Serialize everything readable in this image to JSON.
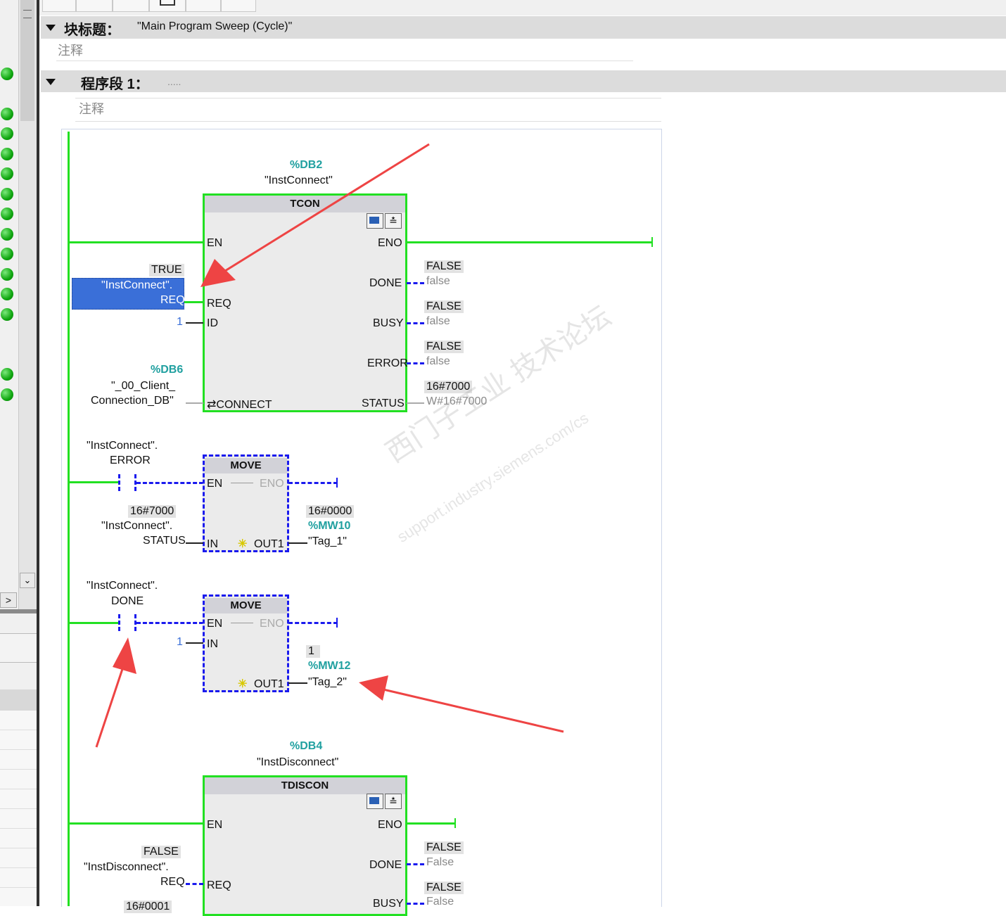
{
  "block": {
    "title_label": "块标题：",
    "title_value": "\"Main Program Sweep (Cycle)\"",
    "comment": "注释"
  },
  "network": {
    "label": "程序段 1：",
    "dots": ".....",
    "comment": "注释"
  },
  "tcon": {
    "db": "%DB2",
    "inst": "\"InstConnect\"",
    "name": "TCON",
    "pin_en": "EN",
    "pin_eno": "ENO",
    "pin_req": "REQ",
    "pin_id": "ID",
    "pin_connect": "⇄CONNECT",
    "pin_done": "DONE",
    "pin_busy": "BUSY",
    "pin_error": "ERROR",
    "pin_status": "STATUS",
    "req_val": "TRUE",
    "req_tag1": "\"InstConnect\".",
    "req_tag2": "REQ",
    "id_val": "1",
    "conn_db": "%DB6",
    "conn_tag1": "\"_00_Client_",
    "conn_tag2": "Connection_DB\"",
    "done_val": "FALSE",
    "done_ref": "false",
    "busy_val": "FALSE",
    "busy_ref": "false",
    "error_val": "FALSE",
    "error_ref": "false",
    "status_val": "16#7000",
    "status_ref": "W#16#7000"
  },
  "move1": {
    "contact_tag1": "\"InstConnect\".",
    "contact_tag2": "ERROR",
    "name": "MOVE",
    "pin_en": "EN",
    "pin_eno": "ENO",
    "pin_in": "IN",
    "pin_out": "OUT1",
    "in_val": "16#7000",
    "in_tag1": "\"InstConnect\".",
    "in_tag2": "STATUS",
    "out_val": "16#0000",
    "out_addr": "%MW10",
    "out_tag": "\"Tag_1\""
  },
  "move2": {
    "contact_tag1": "\"InstConnect\".",
    "contact_tag2": "DONE",
    "name": "MOVE",
    "pin_en": "EN",
    "pin_eno": "ENO",
    "pin_in": "IN",
    "pin_out": "OUT1",
    "in_val": "1",
    "out_val": "1",
    "out_addr": "%MW12",
    "out_tag": "\"Tag_2\""
  },
  "tdiscon": {
    "db": "%DB4",
    "inst": "\"InstDisconnect\"",
    "name": "TDISCON",
    "pin_en": "EN",
    "pin_eno": "ENO",
    "pin_req": "REQ",
    "pin_done": "DONE",
    "pin_busy": "BUSY",
    "req_val": "FALSE",
    "req_tag1": "\"InstDisconnect\".",
    "req_tag2": "REQ",
    "done_val": "FALSE",
    "done_ref": "False",
    "busy_val": "FALSE",
    "busy_ref": "False",
    "partial_val": "16#0001"
  },
  "watermark": {
    "line1": "西门子工业 技术论坛",
    "line2": "support.industry.siemens.com/cs"
  },
  "icons": [
    "status-led-icon",
    "scroll-down-icon",
    "scroll-right-icon",
    "block-icon",
    "diagnostic-icon",
    "collapse-triangle-icon",
    "annotation-arrow-icon"
  ],
  "colors": {
    "rung": "#22e022",
    "dashed": "#1a1aee",
    "selection": "#3a6fd8",
    "accent_teal": "#20a0a0",
    "arrow": "#ee4444"
  }
}
